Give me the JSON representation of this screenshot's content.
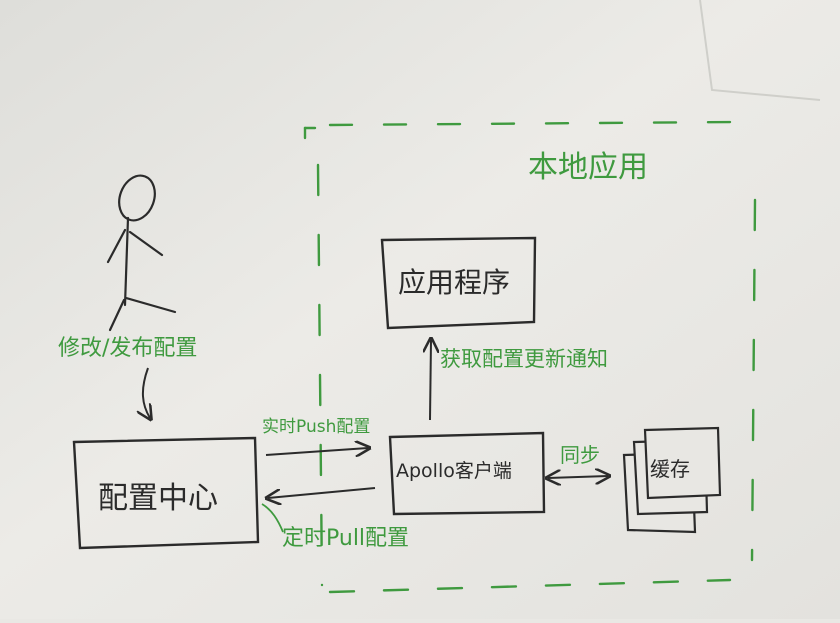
{
  "title": "本地应用",
  "actor_action": "修改/发布配置",
  "config_center": "配置中心",
  "app_program": "应用程序",
  "apollo_client": "Apollo客户端",
  "cache": "缓存",
  "edges": {
    "push": "实时Push配置",
    "pull": "定时Pull配置",
    "notify": "获取配置更新通知",
    "sync": "同步"
  },
  "colors": {
    "ink": "#2b2b2b",
    "green": "#3f9a3f",
    "paper": "#e9e8e4"
  }
}
